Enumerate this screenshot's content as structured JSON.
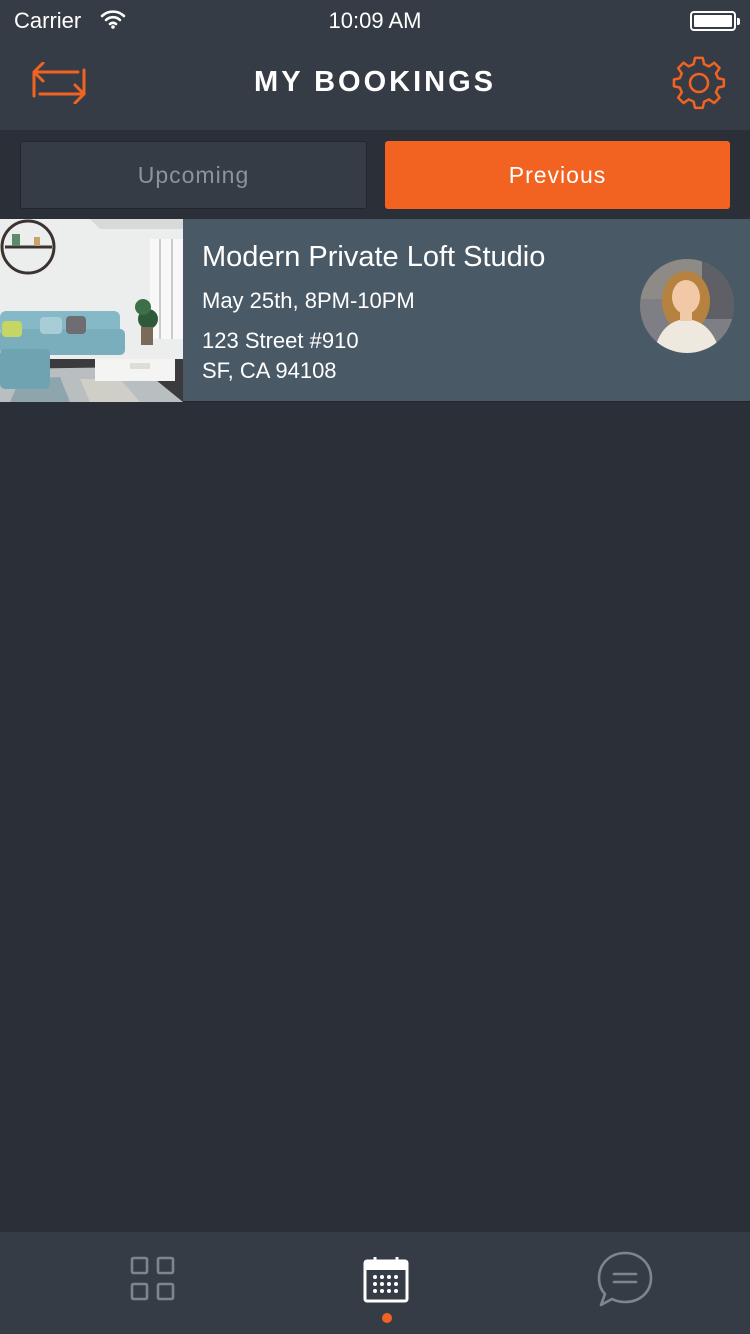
{
  "status_bar": {
    "carrier": "Carrier",
    "time": "10:09 AM"
  },
  "nav": {
    "title": "MY BOOKINGS",
    "left_icon": "switch-arrows-icon",
    "right_icon": "gear-icon"
  },
  "tabs": {
    "upcoming": "Upcoming",
    "previous": "Previous",
    "selected": "previous"
  },
  "bookings": [
    {
      "title": "Modern Private Loft Studio",
      "date": "May 25th, 8PM-10PM",
      "address_line1": "123 Street #910",
      "address_line2": "SF, CA 94108"
    }
  ],
  "tab_bar": {
    "items": [
      "grid-icon",
      "calendar-icon",
      "chat-icon"
    ],
    "active": "calendar-icon"
  },
  "colors": {
    "accent": "#f26322",
    "background": "#2b2f38",
    "bar": "#363c45",
    "card": "#4a5966"
  }
}
